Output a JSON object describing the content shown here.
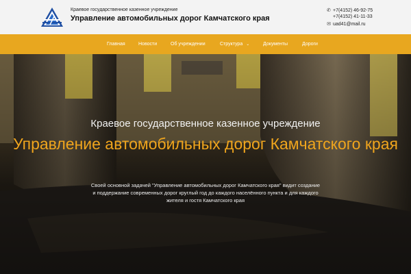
{
  "header": {
    "org_subtitle": "Краевое государственное казенное учреждение",
    "org_title": "Управление автомобильных дорог Камчатского края",
    "contacts": [
      {
        "icon": "phone-icon",
        "text": "+7(4152) 46-92-75"
      },
      {
        "icon": "none",
        "text": "+7(4152) 41-11-33"
      },
      {
        "icon": "envelope-icon",
        "text": "uad41@mail.ru"
      }
    ]
  },
  "nav": {
    "items": [
      {
        "label": "Главная"
      },
      {
        "label": "Новости"
      },
      {
        "label": "Об учреждении"
      },
      {
        "label": "Структура",
        "has_dropdown": true
      },
      {
        "label": "Документы"
      },
      {
        "label": "Дороги"
      }
    ]
  },
  "hero": {
    "subtitle": "Краевое государственное казенное учреждение",
    "title": "Управление автомобильных дорог Камчатского края",
    "description": "Своей основной задачей \"Управление автомобильных дорог Камчатского края\" видит создание и поддержание современных дорог круглый год до каждого населённого пункта и для каждого жителя и гостя Камчатского края"
  },
  "colors": {
    "nav_bg": "#e8a71f",
    "accent_title": "#f0a51d",
    "header_bg": "#f3f3f3"
  }
}
